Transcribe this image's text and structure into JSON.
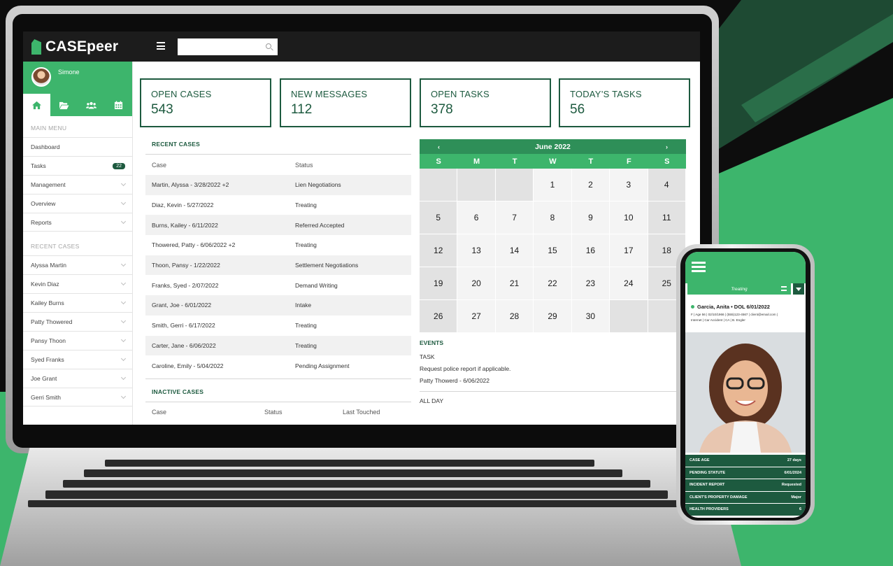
{
  "brand": {
    "name": "CASEpeer"
  },
  "search": {
    "placeholder": ""
  },
  "user": {
    "name": "Simone"
  },
  "sidebar": {
    "main_menu_heading": "MAIN MENU",
    "main_items": [
      {
        "label": "Dashboard"
      },
      {
        "label": "Tasks",
        "badge": "22"
      },
      {
        "label": "Management"
      },
      {
        "label": "Overview"
      },
      {
        "label": "Reports"
      }
    ],
    "recent_heading": "RECENT CASES",
    "recent_items": [
      {
        "label": "Alyssa Martin"
      },
      {
        "label": "Kevin Diaz"
      },
      {
        "label": "Kailey Burns"
      },
      {
        "label": "Patty Thowered"
      },
      {
        "label": "Pansy Thoon"
      },
      {
        "label": "Syed Franks"
      },
      {
        "label": "Joe Grant"
      },
      {
        "label": "Gerri Smith"
      }
    ]
  },
  "stats": [
    {
      "label": "OPEN CASES",
      "value": "543"
    },
    {
      "label": "NEW MESSAGES",
      "value": "112"
    },
    {
      "label": "OPEN TASKS",
      "value": "378"
    },
    {
      "label": "TODAY’S TASKS",
      "value": "56"
    }
  ],
  "recent_cases": {
    "title": "RECENT CASES",
    "columns": [
      "Case",
      "Status"
    ],
    "rows": [
      {
        "case": "Martin, Alyssa - 3/28/2022 +2",
        "status": "Lien Negotiations"
      },
      {
        "case": "Diaz, Kevin - 5/27/2022",
        "status": "Treating"
      },
      {
        "case": "Burns, Kailey - 6/11/2022",
        "status": "Referred Accepted"
      },
      {
        "case": "Thowered, Patty - 6/06/2022 +2",
        "status": "Treating"
      },
      {
        "case": "Thoon, Pansy - 1/22/2022",
        "status": "Settlement Negotiations"
      },
      {
        "case": "Franks, Syed - 2/07/2022",
        "status": "Demand Writing"
      },
      {
        "case": "Grant, Joe - 6/01/2022",
        "status": "Intake"
      },
      {
        "case": "Smith, Gerri - 6/17/2022",
        "status": "Treating"
      },
      {
        "case": "Carter, Jane - 6/06/2022",
        "status": "Treating"
      },
      {
        "case": "Caroline, Emily - 5/04/2022",
        "status": "Pending Assignment"
      }
    ]
  },
  "inactive_cases": {
    "title": "INACTIVE CASES",
    "columns": [
      "Case",
      "Status",
      "Last Touched"
    ]
  },
  "calendar": {
    "month": "June 2022",
    "prev": "‹",
    "next": "›",
    "days": [
      "S",
      "M",
      "T",
      "W",
      "T",
      "F",
      "S"
    ],
    "cells": [
      "",
      "",
      "",
      "1",
      "2",
      "3",
      "4",
      "5",
      "6",
      "7",
      "8",
      "9",
      "10",
      "11",
      "12",
      "13",
      "14",
      "15",
      "16",
      "17",
      "18",
      "19",
      "20",
      "21",
      "22",
      "23",
      "24",
      "25",
      "26",
      "27",
      "28",
      "29",
      "30",
      "",
      ""
    ]
  },
  "events": {
    "title": "EVENTS",
    "type": "TASK",
    "description": "Request police report if applicable.",
    "who": "Patty Thowerd - 6/06/2022",
    "all_day": "ALL DAY"
  },
  "phone": {
    "status": "Treating",
    "client": "Garcia, Anita • DOL 6/01/2022",
    "info_line1": "F | Age 56 | 02/10/1966 | (555)123-4567 | client@email.com |",
    "info_line2": "Internet | Car Accident | CA | B. Engler",
    "rows": [
      {
        "label": "CASE AGE",
        "value": "27 days"
      },
      {
        "label": "PENDING STATUTE",
        "value": "6/01/2024"
      },
      {
        "label": "INCIDENT REPORT",
        "value": "Requested"
      },
      {
        "label": "CLIENT'S PROPERTY DAMAGE",
        "value": "Major"
      },
      {
        "label": "HEALTH PROVIDERS",
        "value": "6"
      }
    ]
  },
  "colors": {
    "brand_green": "#3db56c",
    "dark_green": "#1d5a3f",
    "topbar": "#1c1c1c"
  }
}
